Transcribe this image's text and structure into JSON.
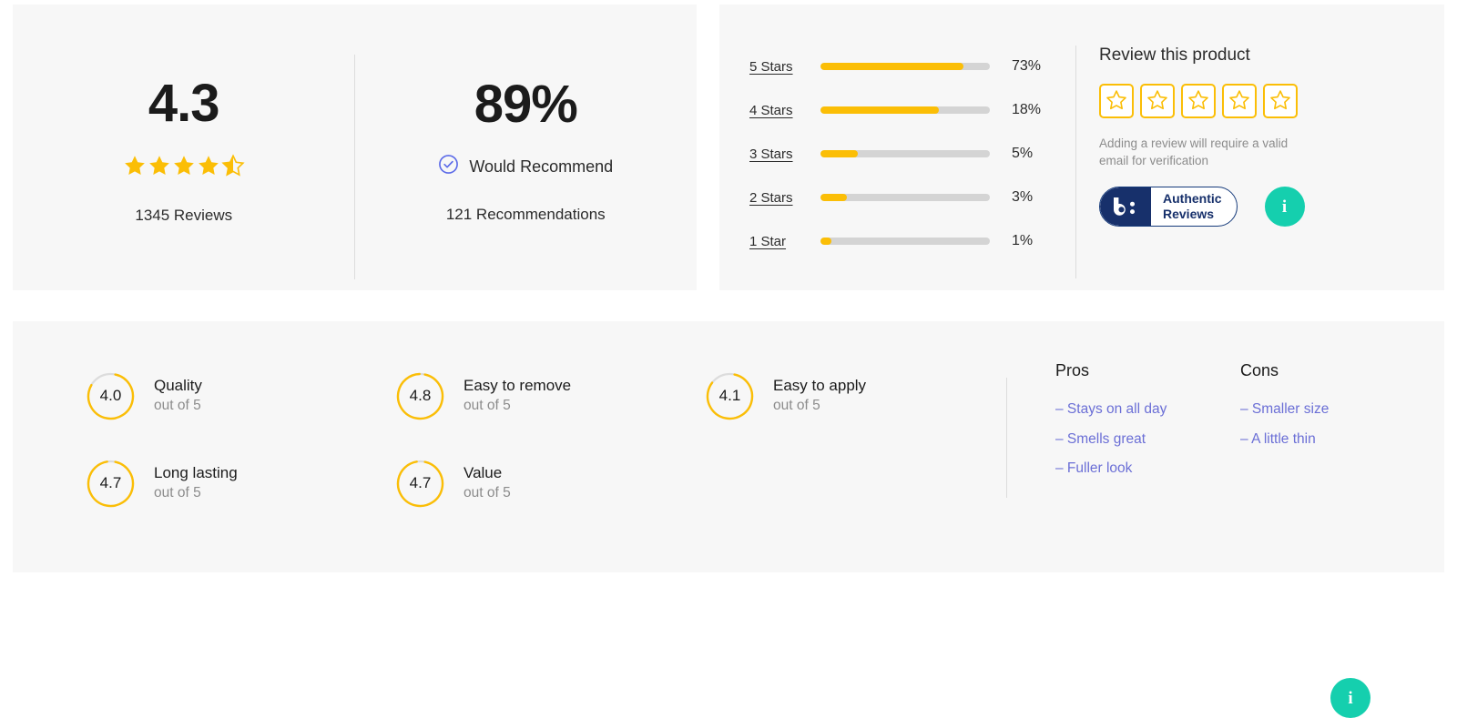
{
  "summary": {
    "average_score": "4.3",
    "star_rating": 4.3,
    "reviews_count_label": "1345 Reviews",
    "recommend_percent": "89%",
    "recommend_label": "Would Recommend",
    "recommendations_count_label": "121 Recommendations",
    "check_icon": "check-circle-icon",
    "star_color": "#fbbe06",
    "check_color": "#5b6ae8"
  },
  "distribution": {
    "rows": [
      {
        "label": "5 Stars",
        "percent_label": "73%",
        "percent": 73,
        "fill_ratio": 0.845
      },
      {
        "label": "4 Stars",
        "percent_label": "18%",
        "percent": 18,
        "fill_ratio": 0.7
      },
      {
        "label": "3 Stars",
        "percent_label": "5%",
        "percent": 5,
        "fill_ratio": 0.22
      },
      {
        "label": "2 Stars",
        "percent_label": "3%",
        "percent": 3,
        "fill_ratio": 0.155
      },
      {
        "label": "1 Star",
        "percent_label": "1%",
        "percent": 1,
        "fill_ratio": 0.065
      }
    ],
    "bar_fill_color": "#fbbe06",
    "bar_track_color": "#d4d4d4"
  },
  "review_cta": {
    "title": "Review this product",
    "star_buttons": [
      {
        "name": "rate-1-star",
        "icon": "star-outline-icon"
      },
      {
        "name": "rate-2-stars",
        "icon": "star-outline-icon"
      },
      {
        "name": "rate-3-stars",
        "icon": "star-outline-icon"
      },
      {
        "name": "rate-4-stars",
        "icon": "star-outline-icon"
      },
      {
        "name": "rate-5-stars",
        "icon": "star-outline-icon"
      }
    ],
    "note": "Adding a review will require a valid email for verification",
    "badge": {
      "logo_glyph": "b:",
      "line1": "Authentic",
      "line2": "Reviews",
      "brand_color": "#17306b"
    },
    "info_icon": "info-icon",
    "info_glyph": "i",
    "info_color": "#15cfae"
  },
  "attributes": {
    "items": [
      {
        "value": "4.0",
        "ratio": 0.8,
        "name": "Quality",
        "out_of": "out of 5"
      },
      {
        "value": "4.7",
        "ratio": 0.94,
        "name": "Long lasting",
        "out_of": "out of 5"
      },
      {
        "value": "4.8",
        "ratio": 0.96,
        "name": "Easy to remove",
        "out_of": "out of 5"
      },
      {
        "value": "4.7",
        "ratio": 0.94,
        "name": "Value",
        "out_of": "out of 5"
      },
      {
        "value": "4.1",
        "ratio": 0.82,
        "name": "Easy to apply",
        "out_of": "out of 5"
      }
    ],
    "ring_color": "#fbbe06",
    "ring_track_color": "#dcdcdc"
  },
  "pros_cons": {
    "pros_heading": "Pros",
    "cons_heading": "Cons",
    "pros": [
      "– Stays on all day",
      "– Smells great",
      "– Fuller look"
    ],
    "cons": [
      "– Smaller size",
      "– A little thin"
    ],
    "link_color": "#6b6fd6",
    "info_icon": "info-icon",
    "info_glyph": "i",
    "info_color": "#15cfae"
  }
}
